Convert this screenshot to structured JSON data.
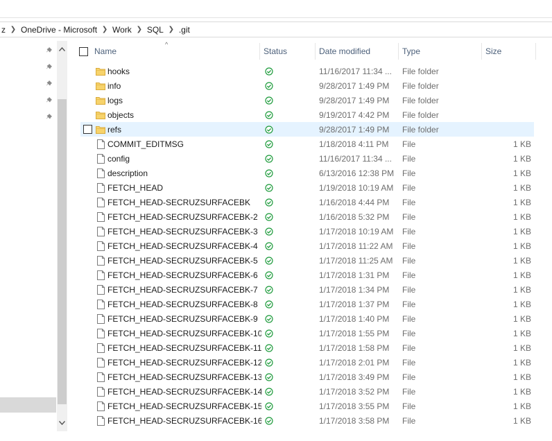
{
  "breadcrumb": [
    "z",
    "OneDrive - Microsoft",
    "Work",
    "SQL",
    ".git"
  ],
  "columns": {
    "name": "Name",
    "status": "Status",
    "date": "Date modified",
    "type": "Type",
    "size": "Size"
  },
  "colors": {
    "accent_selected": "#e5f3ff",
    "header_text": "#4c607a",
    "status_green": "#1e9b3c",
    "folder": "#f7d36b"
  },
  "files": [
    {
      "name": "hooks",
      "kind": "folder",
      "date": "11/16/2017 11:34 ...",
      "type": "File folder",
      "size": ""
    },
    {
      "name": "info",
      "kind": "folder",
      "date": "9/28/2017 1:49 PM",
      "type": "File folder",
      "size": ""
    },
    {
      "name": "logs",
      "kind": "folder",
      "date": "9/28/2017 1:49 PM",
      "type": "File folder",
      "size": ""
    },
    {
      "name": "objects",
      "kind": "folder",
      "date": "9/19/2017 4:42 PM",
      "type": "File folder",
      "size": ""
    },
    {
      "name": "refs",
      "kind": "folder",
      "date": "9/28/2017 1:49 PM",
      "type": "File folder",
      "size": "",
      "selected": true
    },
    {
      "name": "COMMIT_EDITMSG",
      "kind": "file",
      "date": "1/18/2018 4:11 PM",
      "type": "File",
      "size": "1 KB"
    },
    {
      "name": "config",
      "kind": "file",
      "date": "11/16/2017 11:34 ...",
      "type": "File",
      "size": "1 KB"
    },
    {
      "name": "description",
      "kind": "file",
      "date": "6/13/2016 12:38 PM",
      "type": "File",
      "size": "1 KB"
    },
    {
      "name": "FETCH_HEAD",
      "kind": "file",
      "date": "1/19/2018 10:19 AM",
      "type": "File",
      "size": "1 KB"
    },
    {
      "name": "FETCH_HEAD-SECRUZSURFACEBK",
      "kind": "file",
      "date": "1/16/2018 4:44 PM",
      "type": "File",
      "size": "1 KB"
    },
    {
      "name": "FETCH_HEAD-SECRUZSURFACEBK-2",
      "kind": "file",
      "date": "1/16/2018 5:32 PM",
      "type": "File",
      "size": "1 KB"
    },
    {
      "name": "FETCH_HEAD-SECRUZSURFACEBK-3",
      "kind": "file",
      "date": "1/17/2018 10:19 AM",
      "type": "File",
      "size": "1 KB"
    },
    {
      "name": "FETCH_HEAD-SECRUZSURFACEBK-4",
      "kind": "file",
      "date": "1/17/2018 11:22 AM",
      "type": "File",
      "size": "1 KB"
    },
    {
      "name": "FETCH_HEAD-SECRUZSURFACEBK-5",
      "kind": "file",
      "date": "1/17/2018 11:25 AM",
      "type": "File",
      "size": "1 KB"
    },
    {
      "name": "FETCH_HEAD-SECRUZSURFACEBK-6",
      "kind": "file",
      "date": "1/17/2018 1:31 PM",
      "type": "File",
      "size": "1 KB"
    },
    {
      "name": "FETCH_HEAD-SECRUZSURFACEBK-7",
      "kind": "file",
      "date": "1/17/2018 1:34 PM",
      "type": "File",
      "size": "1 KB"
    },
    {
      "name": "FETCH_HEAD-SECRUZSURFACEBK-8",
      "kind": "file",
      "date": "1/17/2018 1:37 PM",
      "type": "File",
      "size": "1 KB"
    },
    {
      "name": "FETCH_HEAD-SECRUZSURFACEBK-9",
      "kind": "file",
      "date": "1/17/2018 1:40 PM",
      "type": "File",
      "size": "1 KB"
    },
    {
      "name": "FETCH_HEAD-SECRUZSURFACEBK-10",
      "kind": "file",
      "date": "1/17/2018 1:55 PM",
      "type": "File",
      "size": "1 KB"
    },
    {
      "name": "FETCH_HEAD-SECRUZSURFACEBK-11",
      "kind": "file",
      "date": "1/17/2018 1:58 PM",
      "type": "File",
      "size": "1 KB"
    },
    {
      "name": "FETCH_HEAD-SECRUZSURFACEBK-12",
      "kind": "file",
      "date": "1/17/2018 2:01 PM",
      "type": "File",
      "size": "1 KB"
    },
    {
      "name": "FETCH_HEAD-SECRUZSURFACEBK-13",
      "kind": "file",
      "date": "1/17/2018 3:49 PM",
      "type": "File",
      "size": "1 KB"
    },
    {
      "name": "FETCH_HEAD-SECRUZSURFACEBK-14",
      "kind": "file",
      "date": "1/17/2018 3:52 PM",
      "type": "File",
      "size": "1 KB"
    },
    {
      "name": "FETCH_HEAD-SECRUZSURFACEBK-15",
      "kind": "file",
      "date": "1/17/2018 3:55 PM",
      "type": "File",
      "size": "1 KB"
    },
    {
      "name": "FETCH_HEAD-SECRUZSURFACEBK-16",
      "kind": "file",
      "date": "1/17/2018 3:58 PM",
      "type": "File",
      "size": "1 KB"
    }
  ]
}
